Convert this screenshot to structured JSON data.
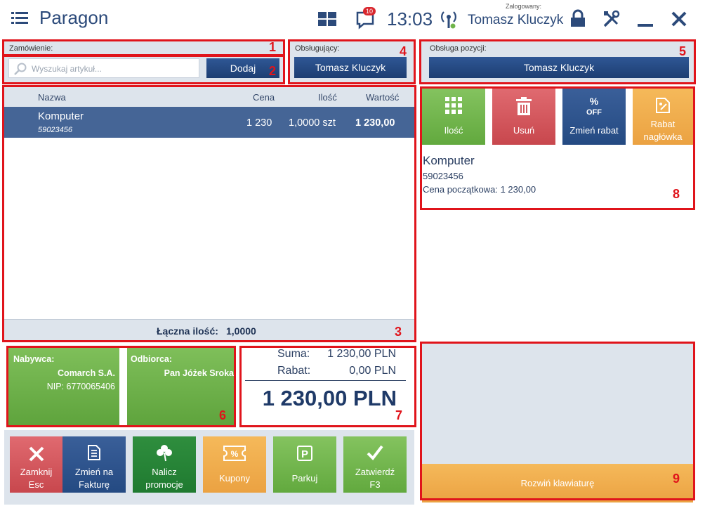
{
  "header": {
    "title": "Paragon",
    "notification_count": "10",
    "time": "13:03",
    "logged_label": "Zalogowany:",
    "logged_user": "Tomasz Kluczyk"
  },
  "order": {
    "label": "Zamówienie:",
    "search_placeholder": "Wyszukaj artykuł...",
    "add_button": "Dodaj"
  },
  "attendant": {
    "label": "Obsługujący:",
    "name": "Tomasz Kluczyk"
  },
  "position_handling": {
    "label": "Obsługa pozycji:",
    "name": "Tomasz Kluczyk"
  },
  "items": {
    "columns": {
      "name": "Nazwa",
      "price": "Cena",
      "quantity": "Ilość",
      "value": "Wartość"
    },
    "rows": [
      {
        "name": "Komputer",
        "code": "59023456",
        "price": "1 230",
        "quantity": "1,0000 szt",
        "value": "1 230,00"
      }
    ],
    "total_quantity_label": "Łączna ilość:",
    "total_quantity_value": "1,0000"
  },
  "item_actions": {
    "quantity": "Ilość",
    "remove": "Usuń",
    "change_discount": "Zmień rabat",
    "header_discount_line1": "Rabat",
    "header_discount_line2": "nagłówka"
  },
  "item_details": {
    "name": "Komputer",
    "code": "59023456",
    "initial_price": "Cena początkowa: 1 230,00"
  },
  "buyer": {
    "label": "Nabywca:",
    "name": "Comarch S.A.",
    "nip": "NIP: 6770065406"
  },
  "recipient": {
    "label": "Odbiorca:",
    "name": "Pan Jóżek Sroka"
  },
  "totals": {
    "sum_label": "Suma:",
    "sum_value": "1 230,00 PLN",
    "discount_label": "Rabat:",
    "discount_value": "0,00 PLN",
    "grand_total": "1 230,00 PLN"
  },
  "bottom_buttons": {
    "close_line1": "Zamknij",
    "close_line2": "Esc",
    "invoice_line1": "Zmień na",
    "invoice_line2": "Fakturę",
    "promo_line1": "Nalicz",
    "promo_line2": "promocje",
    "coupons": "Kupony",
    "park": "Parkuj",
    "confirm_line1": "Zatwierdź",
    "confirm_line2": "F3"
  },
  "keyboard": {
    "expand": "Rozwiń klawiaturę"
  },
  "callouts": [
    "1",
    "2",
    "3",
    "4",
    "5",
    "6",
    "7",
    "8",
    "9"
  ],
  "colors": {
    "accent_blue": "#2f5795",
    "row_selected": "#456596",
    "green": "#6fb44a",
    "red": "#d9535a",
    "orange": "#f0aa45",
    "callout_red": "#e0141b"
  }
}
